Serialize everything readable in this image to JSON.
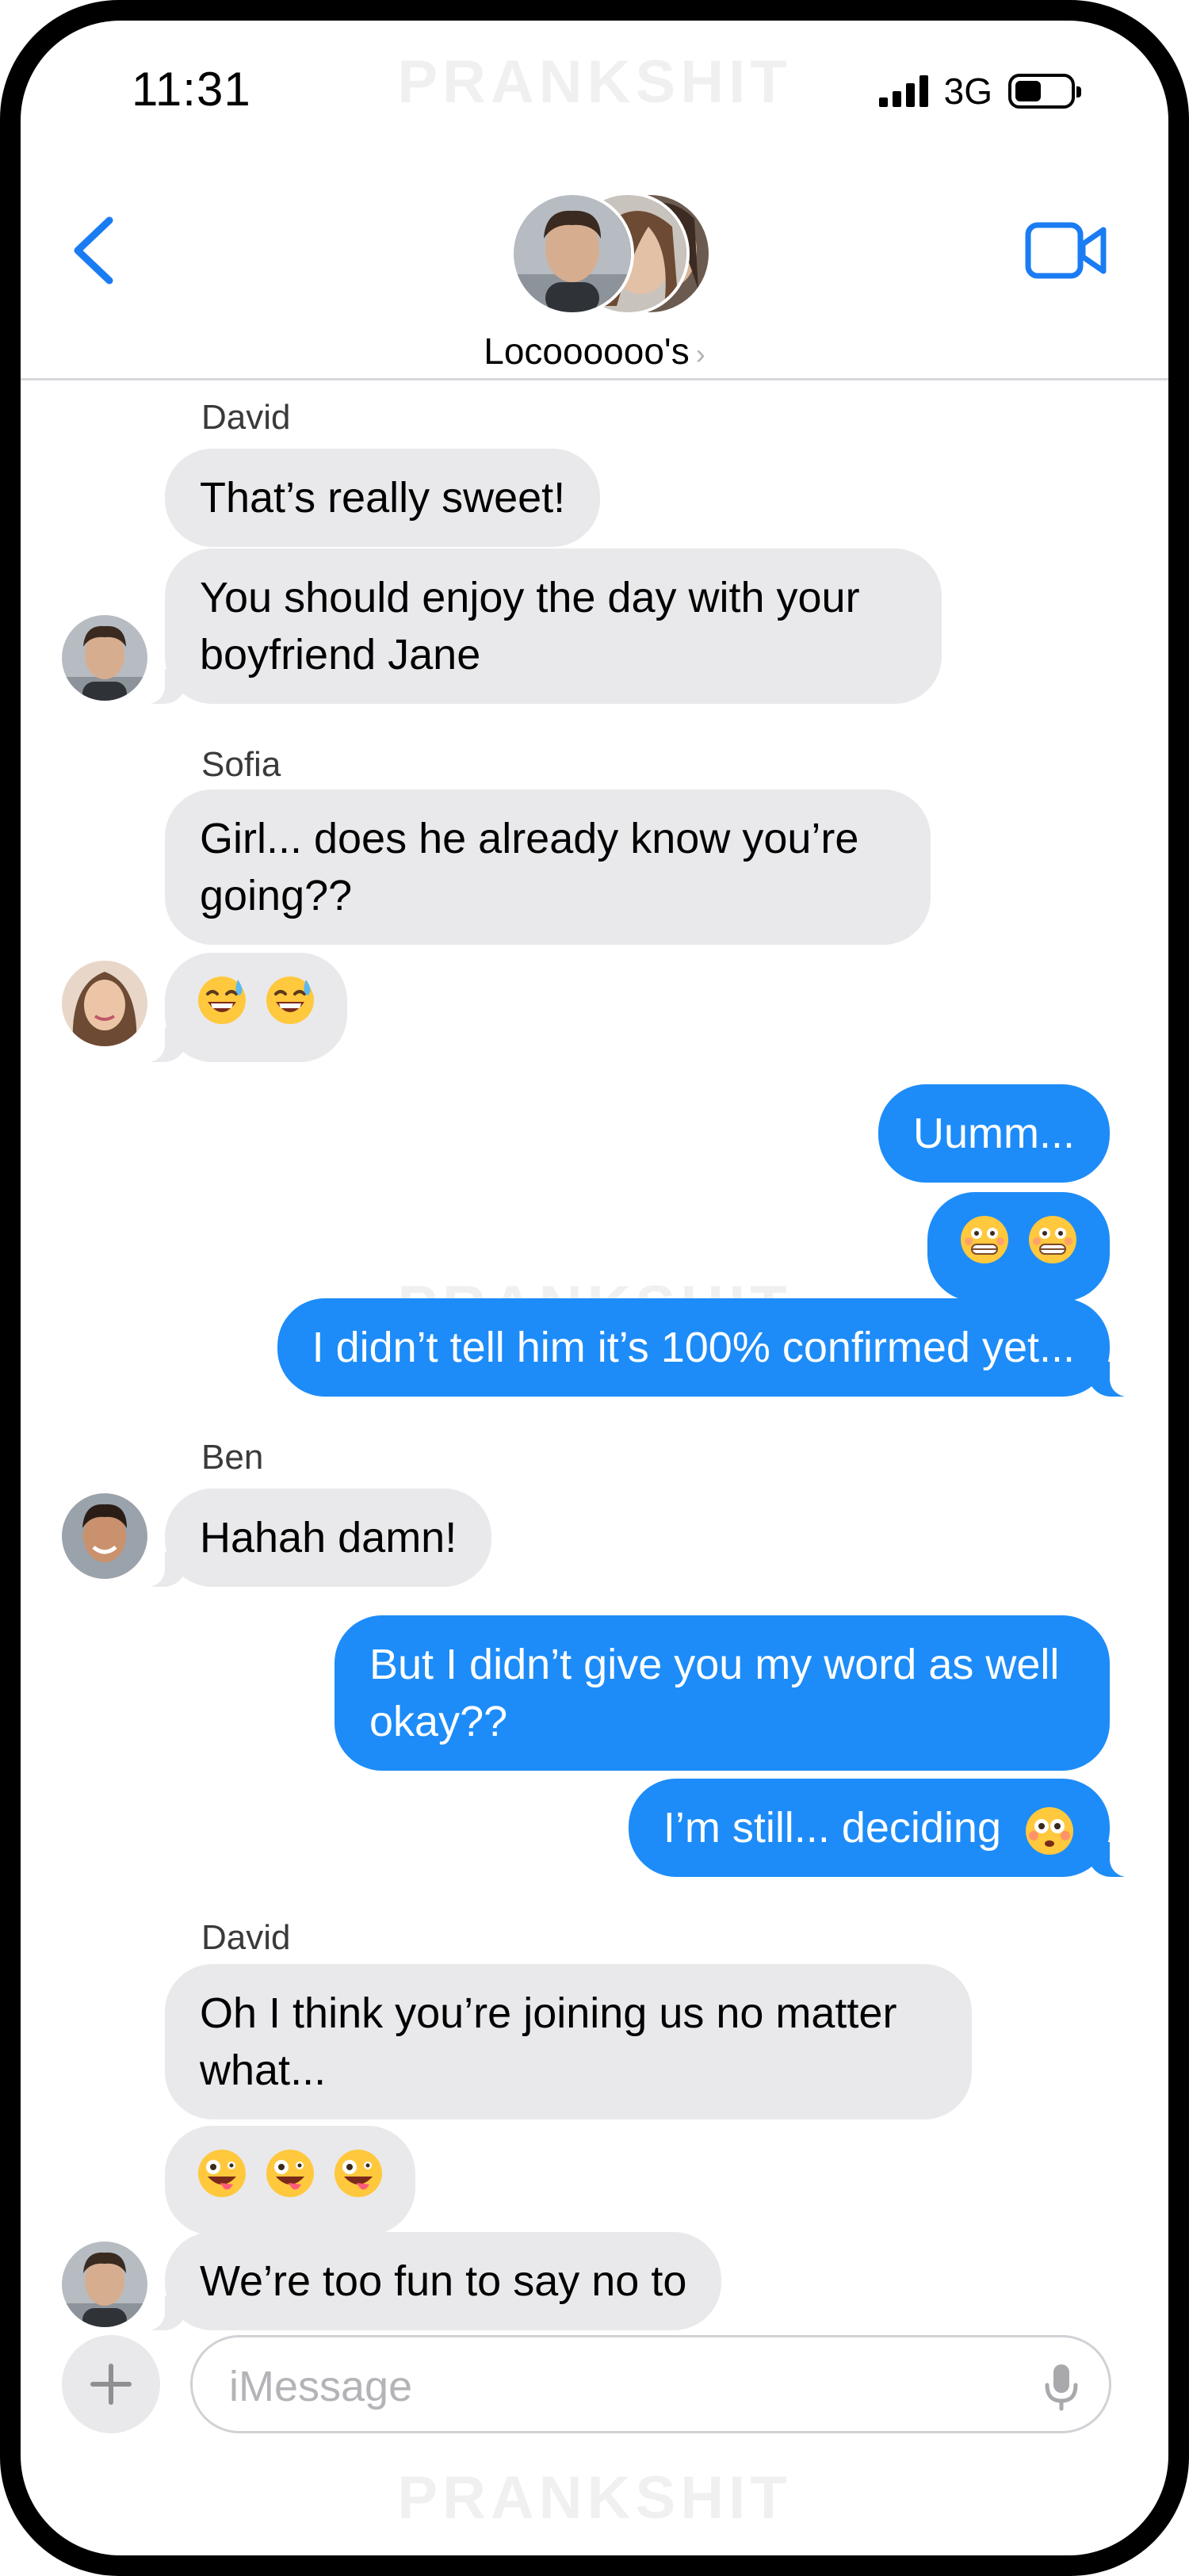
{
  "status_bar": {
    "time": "11:31",
    "network": "3G"
  },
  "watermark": "PRANKSHIT",
  "header": {
    "group_name": "Locoooooo's",
    "chevron": "›"
  },
  "messages": [
    {
      "sender": "David"
    },
    {
      "text": "That’s really sweet!"
    },
    {
      "line1": "You should enjoy the day with your",
      "line2": "boyfriend Jane"
    },
    {
      "sender": "Sofia"
    },
    {
      "line1": "Girl... does he already know you’re",
      "line2": "going??"
    },
    {
      "emoji": [
        "sweat-smile-emoji",
        "sweat-smile-emoji"
      ]
    },
    {
      "text": "Uumm..."
    },
    {
      "emoji": [
        "grimace-flushed-emoji",
        "grimace-flushed-emoji"
      ]
    },
    {
      "text": "I didn’t tell him it’s 100% confirmed yet..."
    },
    {
      "sender": "Ben"
    },
    {
      "text": "Hahah damn!"
    },
    {
      "line1": "But I didn’t give you my word as well",
      "line2": "okay??"
    },
    {
      "text": "I’m still... deciding"
    },
    {
      "sender": "David"
    },
    {
      "line1": "Oh I think you’re joining us no matter",
      "line2": "what..."
    },
    {
      "emoji": [
        "zany-face-emoji",
        "zany-face-emoji",
        "zany-face-emoji"
      ]
    },
    {
      "text": "We’re too fun to say no to"
    }
  ],
  "input": {
    "placeholder": "iMessage"
  },
  "colors": {
    "outgoing": "#1d8cf8",
    "incoming": "#e9e9eb",
    "accent": "#1a7cf2"
  }
}
